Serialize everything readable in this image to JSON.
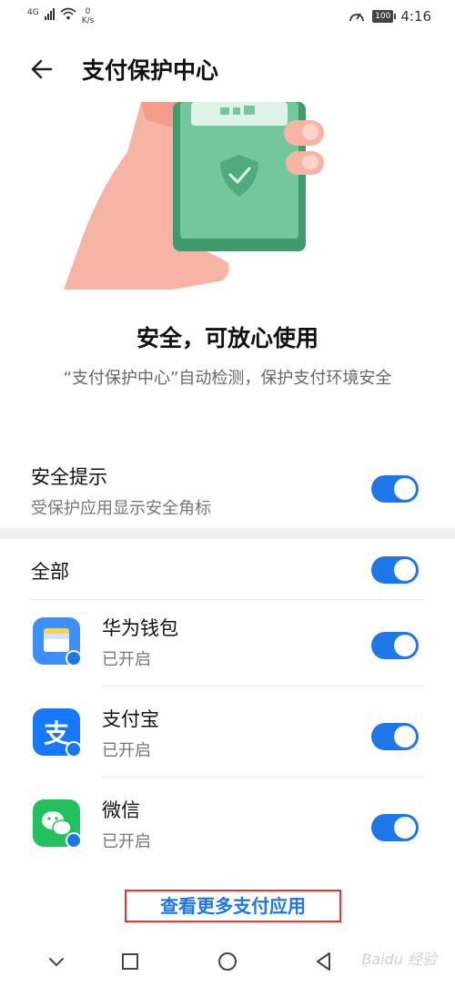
{
  "status_bar": {
    "network": "4G",
    "speed_value": "0",
    "speed_unit": "K/s",
    "battery": "100",
    "time": "4:16"
  },
  "header": {
    "title": "支付保护中心",
    "back_icon": "arrow-left-icon"
  },
  "status": {
    "title": "安全，可放心使用",
    "description": "“支付保护中心”自动检测，保护支付环境安全"
  },
  "security_tip": {
    "title": "安全提示",
    "subtitle": "受保护应用显示安全角标",
    "enabled": true
  },
  "all_toggle": {
    "label": "全部",
    "enabled": true
  },
  "apps": [
    {
      "name": "华为钱包",
      "status": "已开启",
      "icon": "huawei-wallet-icon",
      "color": "#3d8ef7",
      "enabled": true
    },
    {
      "name": "支付宝",
      "status": "已开启",
      "icon": "alipay-icon",
      "color": "#1677ff",
      "enabled": true
    },
    {
      "name": "微信",
      "status": "已开启",
      "icon": "wechat-icon",
      "color": "#22c15e",
      "enabled": true
    }
  ],
  "more_link": "查看更多支付应用",
  "nav": {
    "back": "nav-back-icon",
    "home": "nav-home-icon",
    "recents": "nav-recents-icon",
    "collapse": "nav-collapse-icon"
  },
  "watermark": "Baidu 经验",
  "colors": {
    "accent": "#1e77e8",
    "highlight_border": "#e53935"
  }
}
